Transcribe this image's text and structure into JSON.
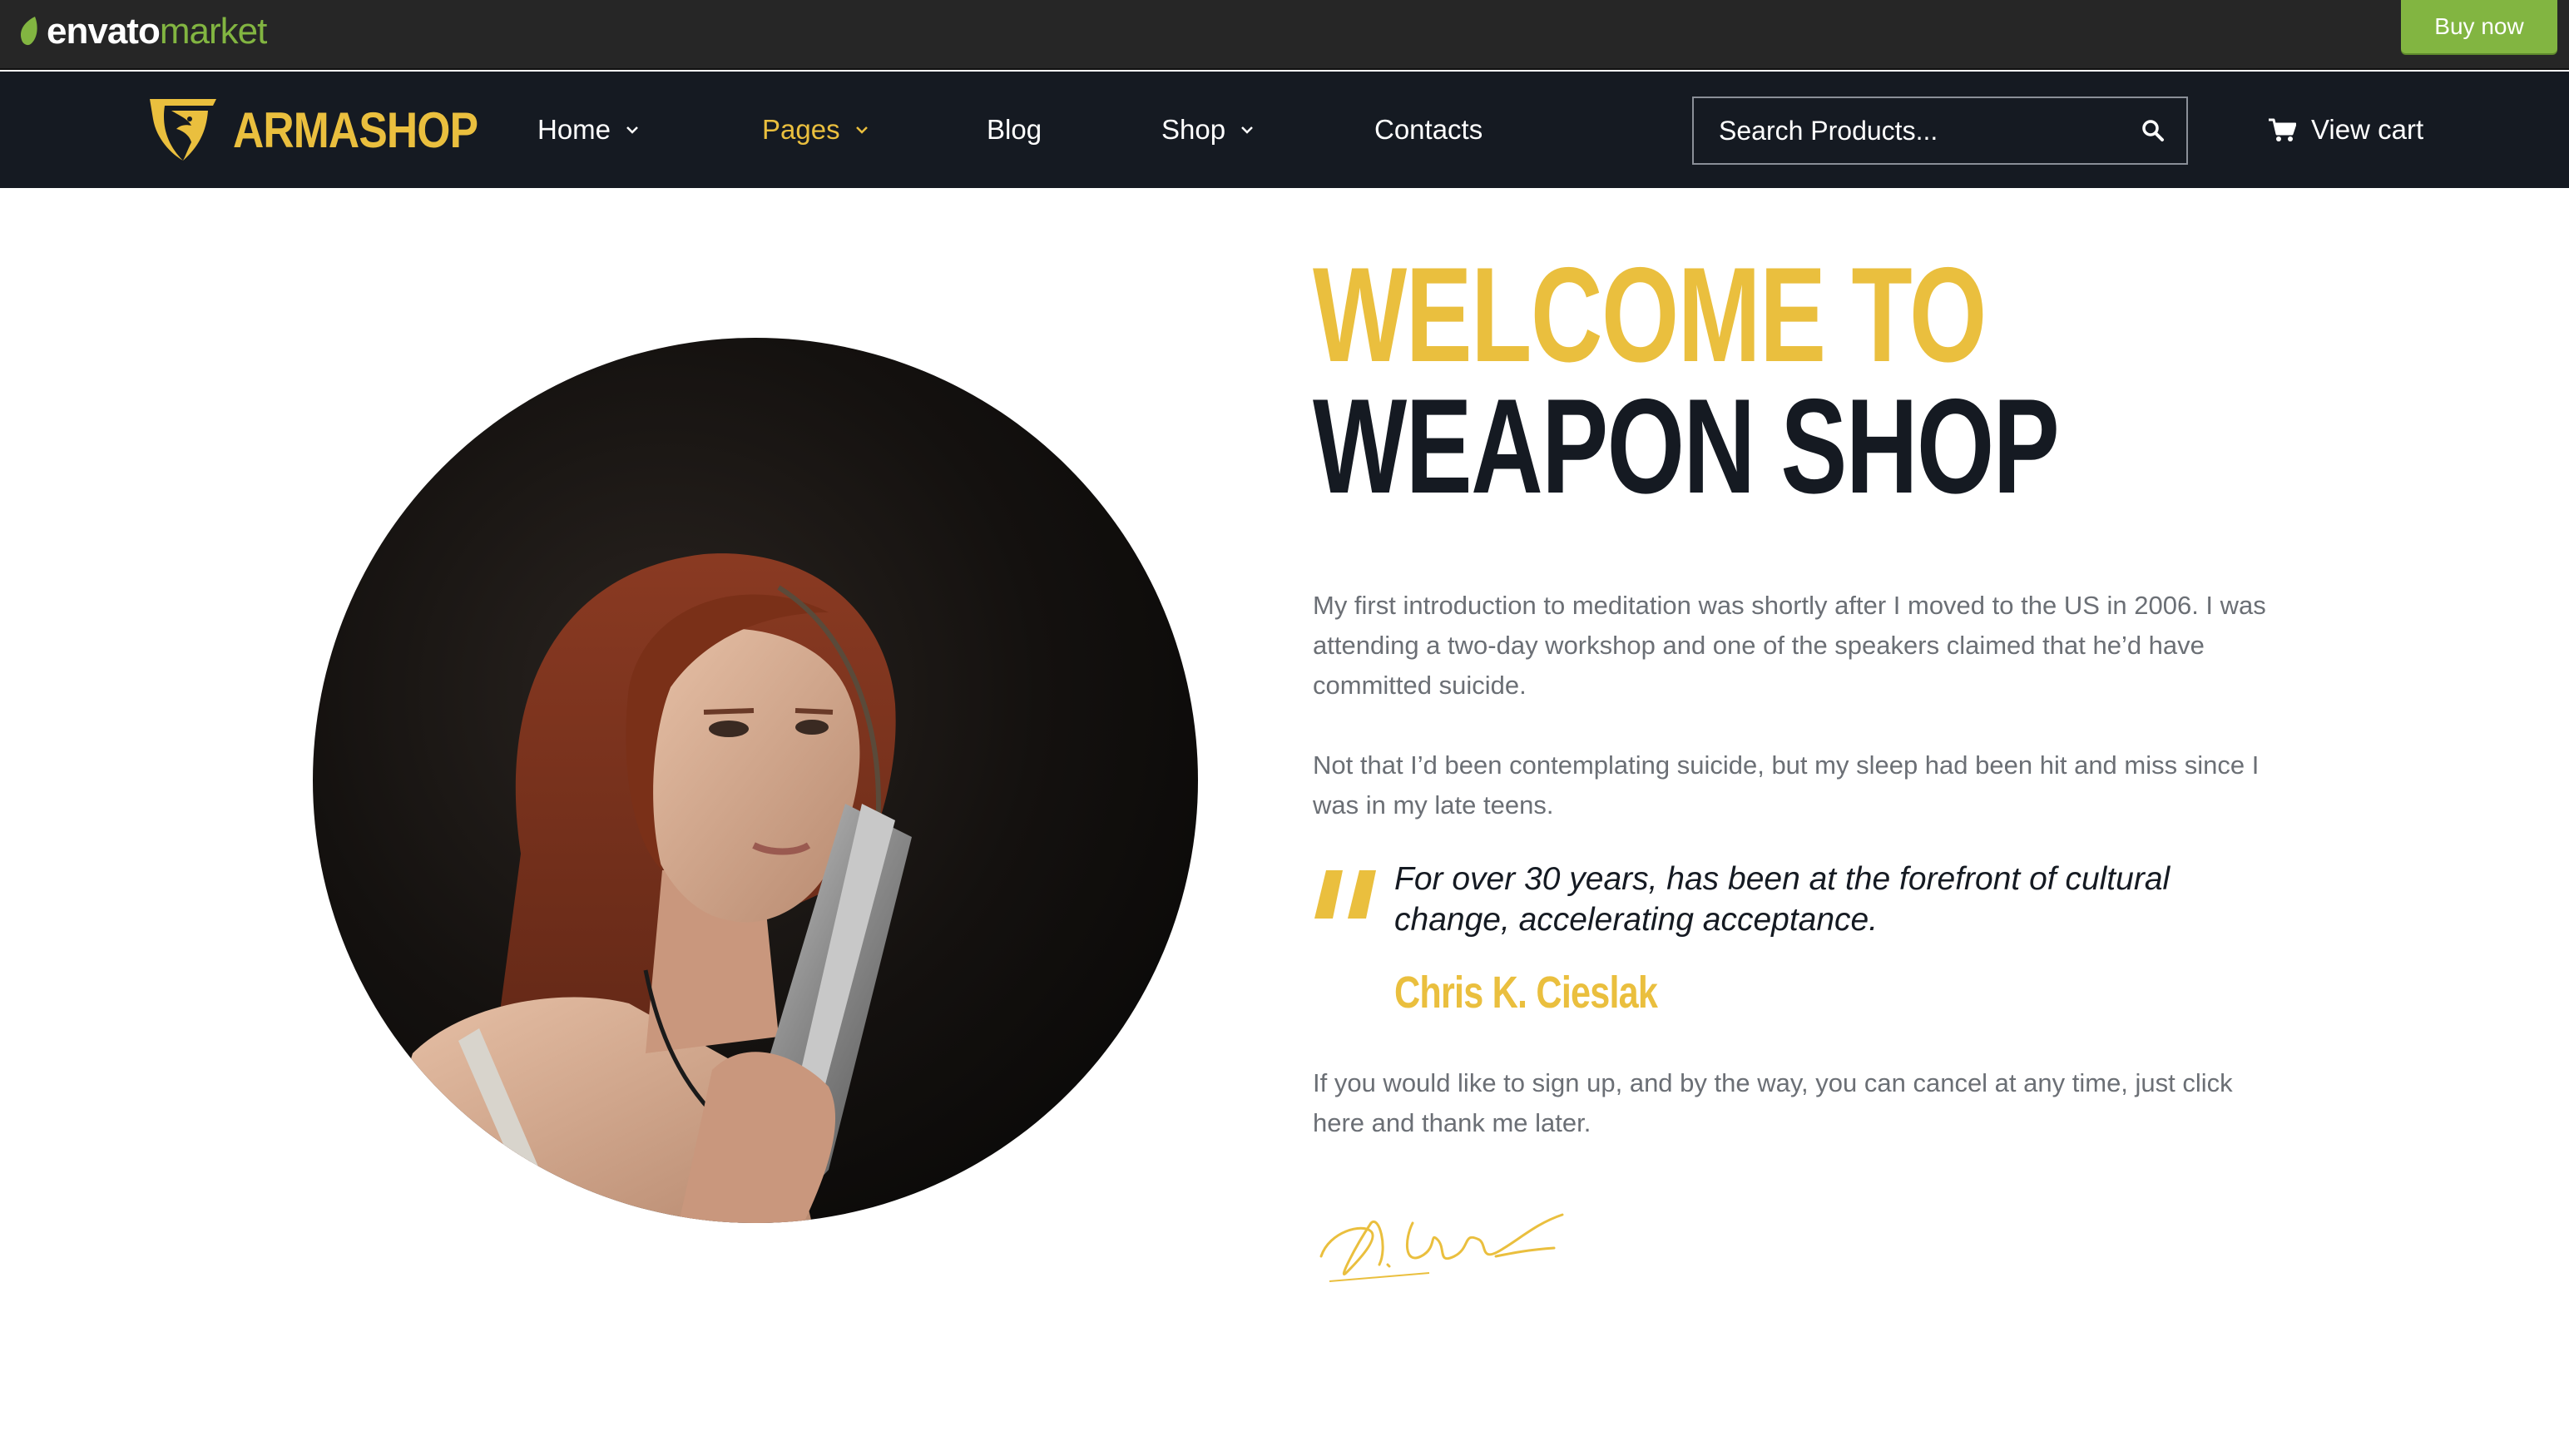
{
  "envato": {
    "logo_envato": "envato",
    "logo_market": "market",
    "buy_now": "Buy now",
    "accent": "#82b541"
  },
  "header": {
    "brand": "ARMASHOP",
    "nav": [
      {
        "label": "Home",
        "has_dropdown": true,
        "active": false
      },
      {
        "label": "Pages",
        "has_dropdown": true,
        "active": true
      },
      {
        "label": "Blog",
        "has_dropdown": false,
        "active": false
      },
      {
        "label": "Shop",
        "has_dropdown": true,
        "active": false
      },
      {
        "label": "Contacts",
        "has_dropdown": false,
        "active": false
      }
    ],
    "search_placeholder": "Search Products...",
    "view_cart": "View cart",
    "bg_color": "#151a22",
    "accent_color": "#eabf3e"
  },
  "hero": {
    "title_line1": "WELCOME TO",
    "title_line2": "WEAPON SHOP",
    "paragraph1": "My first introduction to meditation was shortly after I moved to the US in 2006. I was attending a two-day workshop and one of the speakers claimed that he’d have committed suicide.",
    "paragraph2": "Not that I’d been contemplating suicide, but my sleep had been hit and miss since I was in my late teens.",
    "quote": "For over 30 years, has been at the forefront of cultural change, accelerating acceptance.",
    "quote_author": "Chris K. Cieslak",
    "paragraph3": "If you would like to sign up, and by the way, you can cancel at any time, just click here and thank me later.",
    "image_icon": "woman-with-pistol-portrait",
    "signature_icon": "handwritten-signature"
  }
}
